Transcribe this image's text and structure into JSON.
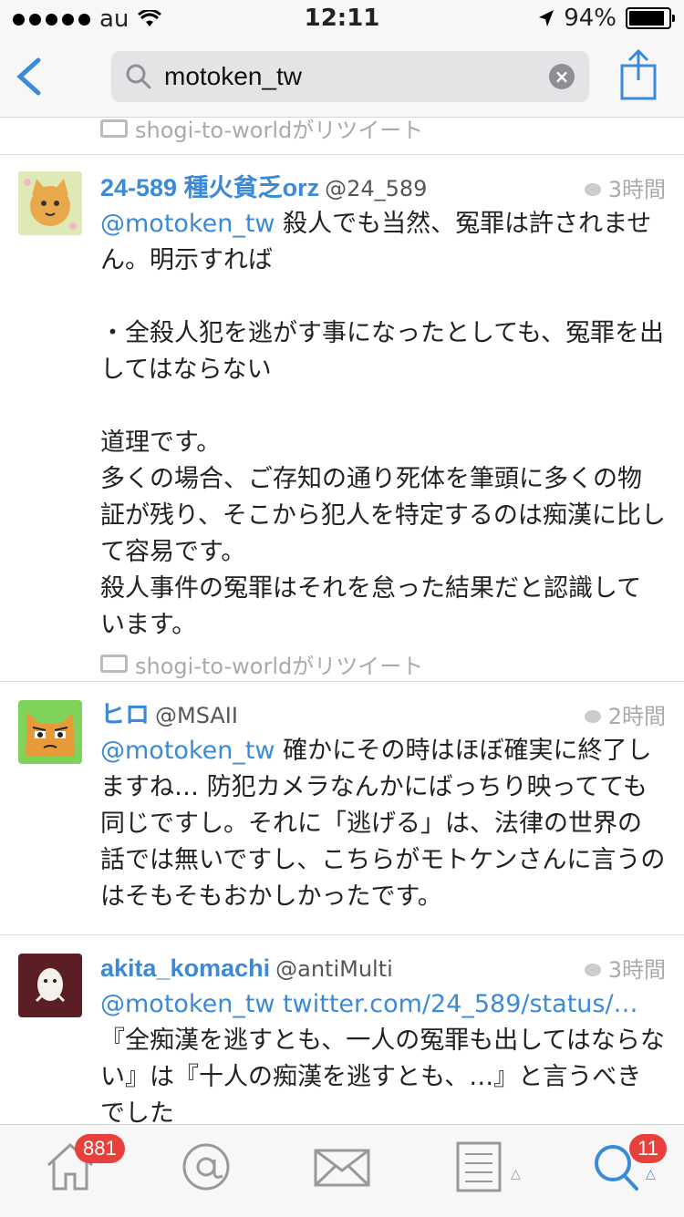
{
  "status_bar": {
    "carrier": "au",
    "time": "12:11",
    "battery": "94%",
    "battery_level": 0.94
  },
  "nav": {
    "search_value": "motoken_tw",
    "search_placeholder": ""
  },
  "top_retweet": "shogi-to-worldがリツイート",
  "tweets": [
    {
      "name": "24-589 種火貧乏orz",
      "handle": "@24_589",
      "time": "3時間",
      "mention": "@motoken_tw",
      "lines": [
        " 殺人でも当然、冤罪は許されません。明示すれば",
        "・全殺人犯を逃がす事になったとしても、冤罪を出してはならない",
        "道理です。",
        "多くの場合、ご存知の通り死体を筆頭に多くの物証が残り、そこから犯人を特定するのは痴漢に比して容易です。",
        "殺人事件の冤罪はそれを怠った結果だと認識しています。"
      ],
      "retweet": "shogi-to-worldがリツイート"
    },
    {
      "name": "ヒロ",
      "handle": "@MSAII",
      "time": "2時間",
      "mention": "@motoken_tw",
      "text": " 確かにその時はほぼ確実に終了しますね… 防犯カメラなんかにばっちり映ってても同じですし。それに「逃げる」は、法律の世界の話では無いですし、こちらがモトケンさんに言うのはそもそもおかしかったです。"
    },
    {
      "name": "akita_komachi",
      "handle": "@antiMulti",
      "time": "3時間",
      "mention": "@motoken_tw",
      "link": " twitter.com/24_589/status/…",
      "text": "『全痴漢を逃すとも、一人の冤罪も出してはならない』は『十人の痴漢を逃すとも、…』と言うべきでした"
    }
  ],
  "tabbar": {
    "home_badge": "881",
    "search_badge": "11"
  },
  "colors": {
    "accent": "#3b8ad8",
    "badge": "#e8413c"
  }
}
